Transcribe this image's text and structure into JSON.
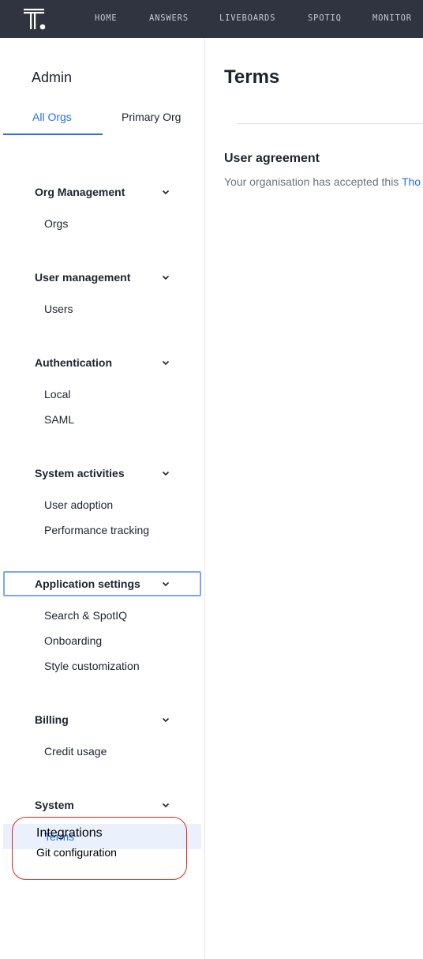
{
  "topbar": {
    "logo_icon": "thoughtspot-logo-icon",
    "nav": [
      "HOME",
      "ANSWERS",
      "LIVEBOARDS",
      "SPOTIQ",
      "MONITOR"
    ]
  },
  "sidebar": {
    "title": "Admin",
    "org_tabs": [
      {
        "label": "All Orgs",
        "active": true
      },
      {
        "label": "Primary Org",
        "active": false
      }
    ],
    "sections": [
      {
        "label": "Org Management",
        "items": [
          "Orgs"
        ]
      },
      {
        "label": "User management",
        "items": [
          "Users"
        ]
      },
      {
        "label": "Authentication",
        "items": [
          "Local",
          "SAML"
        ]
      },
      {
        "label": "System activities",
        "items": [
          "User adoption",
          "Performance tracking"
        ]
      },
      {
        "label": "Application settings",
        "items": [
          "Search & SpotIQ",
          "Onboarding",
          "Style customization"
        ]
      },
      {
        "label": "Billing",
        "items": [
          "Credit usage"
        ]
      },
      {
        "label": "System",
        "items": [
          "Terms"
        ]
      }
    ],
    "integrations": {
      "title": "Integrations",
      "items": [
        "Git configuration"
      ]
    }
  },
  "main": {
    "title": "Terms",
    "agreement": {
      "title": "User agreement",
      "text": "Your organisation has accepted this ",
      "link": "Tho"
    }
  },
  "colors": {
    "accent": "#2770ef",
    "topbar": "#2f3440",
    "highlight": "#e0281c"
  }
}
